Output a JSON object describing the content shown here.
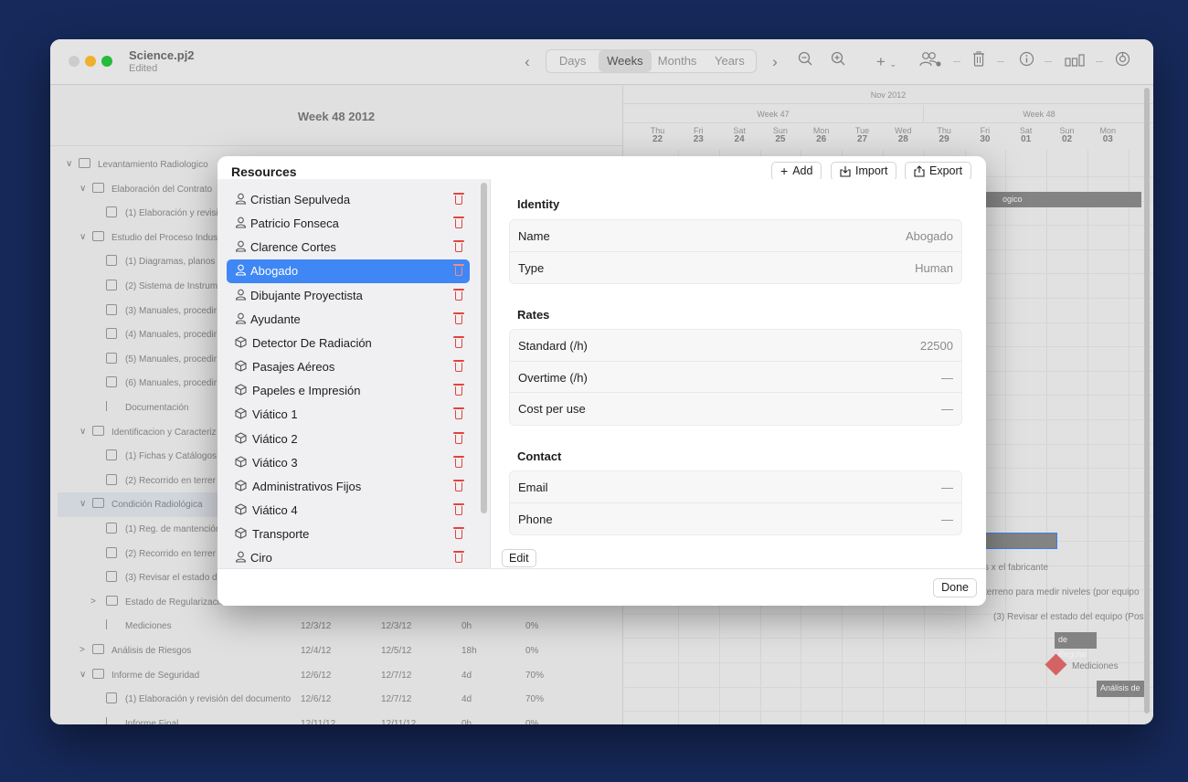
{
  "window": {
    "doc_title": "Science.pj2",
    "doc_status": "Edited"
  },
  "toolbar": {
    "scales": [
      "Days",
      "Weeks",
      "Months",
      "Years"
    ],
    "selected_scale": "Weeks"
  },
  "outline": {
    "week_header": "Week 48 2012",
    "rows": [
      {
        "label": "Levantamiento Radiologico",
        "chev": "v",
        "icon": "folder",
        "level": 0
      },
      {
        "label": "Elaboración del Contrato",
        "chev": "v",
        "icon": "folder",
        "level": 1
      },
      {
        "label": "(1) Elaboración y revisi",
        "chev": "",
        "icon": "task",
        "level": 2
      },
      {
        "label": "Estudio del Proceso Indus",
        "chev": "v",
        "icon": "folder",
        "level": 1
      },
      {
        "label": "(1) Diagramas, planos",
        "chev": "",
        "icon": "task",
        "level": 2
      },
      {
        "label": "(2) Sistema de Instrum",
        "chev": "",
        "icon": "task",
        "level": 2
      },
      {
        "label": "(3) Manuales, procedir",
        "chev": "",
        "icon": "task",
        "level": 2
      },
      {
        "label": "(4) Manuales, procedir",
        "chev": "",
        "icon": "task",
        "level": 2
      },
      {
        "label": "(5) Manuales, procedir",
        "chev": "",
        "icon": "task",
        "level": 2
      },
      {
        "label": "(6) Manuales, procedir",
        "chev": "",
        "icon": "task",
        "level": 2
      },
      {
        "label": "Documentación",
        "chev": "",
        "icon": "flag",
        "level": 2
      },
      {
        "label": "Identificacion y Caracteriz",
        "chev": "v",
        "icon": "folder",
        "level": 1
      },
      {
        "label": "(1) Fichas y Catálogos",
        "chev": "",
        "icon": "task",
        "level": 2
      },
      {
        "label": "(2) Recorrido en terrer",
        "chev": "",
        "icon": "task",
        "level": 2
      },
      {
        "label": "Condición Radiológica",
        "chev": "v",
        "icon": "folder",
        "level": 1
      },
      {
        "label": "(1) Reg. de mantención",
        "chev": "",
        "icon": "task",
        "level": 2
      },
      {
        "label": "(2) Recorrido en terrer",
        "chev": "",
        "icon": "task",
        "level": 2
      },
      {
        "label": "(3) Revisar el estado d",
        "chev": "",
        "icon": "task",
        "level": 2
      },
      {
        "label": "Estado de Regularizacio",
        "chev": ">",
        "icon": "folder",
        "level": 2
      },
      {
        "label": "Mediciones",
        "chev": "",
        "icon": "flag",
        "level": 2,
        "start": "12/3/12",
        "end": "12/3/12",
        "dur": "0h",
        "pct": "0%"
      },
      {
        "label": "Análisis de Riesgos",
        "chev": ">",
        "icon": "folder",
        "level": 1,
        "start": "12/4/12",
        "end": "12/5/12",
        "dur": "18h",
        "pct": "0%"
      },
      {
        "label": "Informe de Seguridad",
        "chev": "v",
        "icon": "folder",
        "level": 1,
        "start": "12/6/12",
        "end": "12/7/12",
        "dur": "4d",
        "pct": "70%"
      },
      {
        "label": "(1) Elaboración y revisión del documento",
        "chev": "",
        "icon": "task",
        "level": 2,
        "start": "12/6/12",
        "end": "12/7/12",
        "dur": "4d",
        "pct": "70%"
      },
      {
        "label": "Informe Final",
        "chev": "",
        "icon": "flag",
        "level": 2,
        "start": "12/11/12",
        "end": "12/11/12",
        "dur": "0h",
        "pct": "0%"
      }
    ]
  },
  "gantt": {
    "month": "Nov 2012",
    "weeks": [
      "Week 47",
      "Week 48"
    ],
    "days": [
      {
        "d": "Thu",
        "n": "22"
      },
      {
        "d": "Fri",
        "n": "23"
      },
      {
        "d": "Sat",
        "n": "24"
      },
      {
        "d": "Sun",
        "n": "25"
      },
      {
        "d": "Mon",
        "n": "26"
      },
      {
        "d": "Tue",
        "n": "27"
      },
      {
        "d": "Wed",
        "n": "28"
      },
      {
        "d": "Thu",
        "n": "29"
      },
      {
        "d": "Fri",
        "n": "30"
      },
      {
        "d": "Sat",
        "n": "01"
      },
      {
        "d": "Sun",
        "n": "02"
      },
      {
        "d": "Mon",
        "n": "03"
      }
    ],
    "bar_top_label": "ogico",
    "label_fabricante": "s x el fabricante",
    "label_terreno": "terreno para medir niveles (por equipo",
    "label_revisar": "(3) Revisar el estado del equipo (Pos",
    "label_regular": "de Regular",
    "label_mediciones": "Mediciones",
    "label_analisis": "Análisis de"
  },
  "dialog": {
    "title": "Resources",
    "add_label": "Add",
    "import_label": "Import",
    "export_label": "Export",
    "edit_label": "Edit",
    "done_label": "Done",
    "selected_index": 3,
    "resources": [
      {
        "name": "Cristian Sepulveda",
        "kind": "person"
      },
      {
        "name": "Patricio Fonseca",
        "kind": "person"
      },
      {
        "name": "Clarence Cortes",
        "kind": "person"
      },
      {
        "name": "Abogado",
        "kind": "person"
      },
      {
        "name": "Dibujante Proyectista",
        "kind": "person"
      },
      {
        "name": "Ayudante",
        "kind": "person"
      },
      {
        "name": "Detector De Radiación",
        "kind": "material"
      },
      {
        "name": "Pasajes Aéreos",
        "kind": "material"
      },
      {
        "name": "Papeles e Impresión",
        "kind": "material"
      },
      {
        "name": "Viático 1",
        "kind": "material"
      },
      {
        "name": "Viático 2",
        "kind": "material"
      },
      {
        "name": "Viático 3",
        "kind": "material"
      },
      {
        "name": "Administrativos Fijos",
        "kind": "material"
      },
      {
        "name": "Viático 4",
        "kind": "material"
      },
      {
        "name": "Transporte",
        "kind": "material"
      },
      {
        "name": "Ciro",
        "kind": "person"
      }
    ],
    "identity": {
      "heading": "Identity",
      "name_label": "Name",
      "name_value": "Abogado",
      "type_label": "Type",
      "type_value": "Human"
    },
    "rates": {
      "heading": "Rates",
      "standard_label": "Standard (/h)",
      "standard_value": "22500",
      "overtime_label": "Overtime (/h)",
      "overtime_value": "—",
      "cost_label": "Cost per use",
      "cost_value": "—"
    },
    "contact": {
      "heading": "Contact",
      "email_label": "Email",
      "email_value": "—",
      "phone_label": "Phone",
      "phone_value": "—"
    }
  },
  "colors": {
    "background": "#16295a",
    "selection": "#3f87f5",
    "delete": "#e0443e",
    "milestone": "#e36a6a"
  }
}
